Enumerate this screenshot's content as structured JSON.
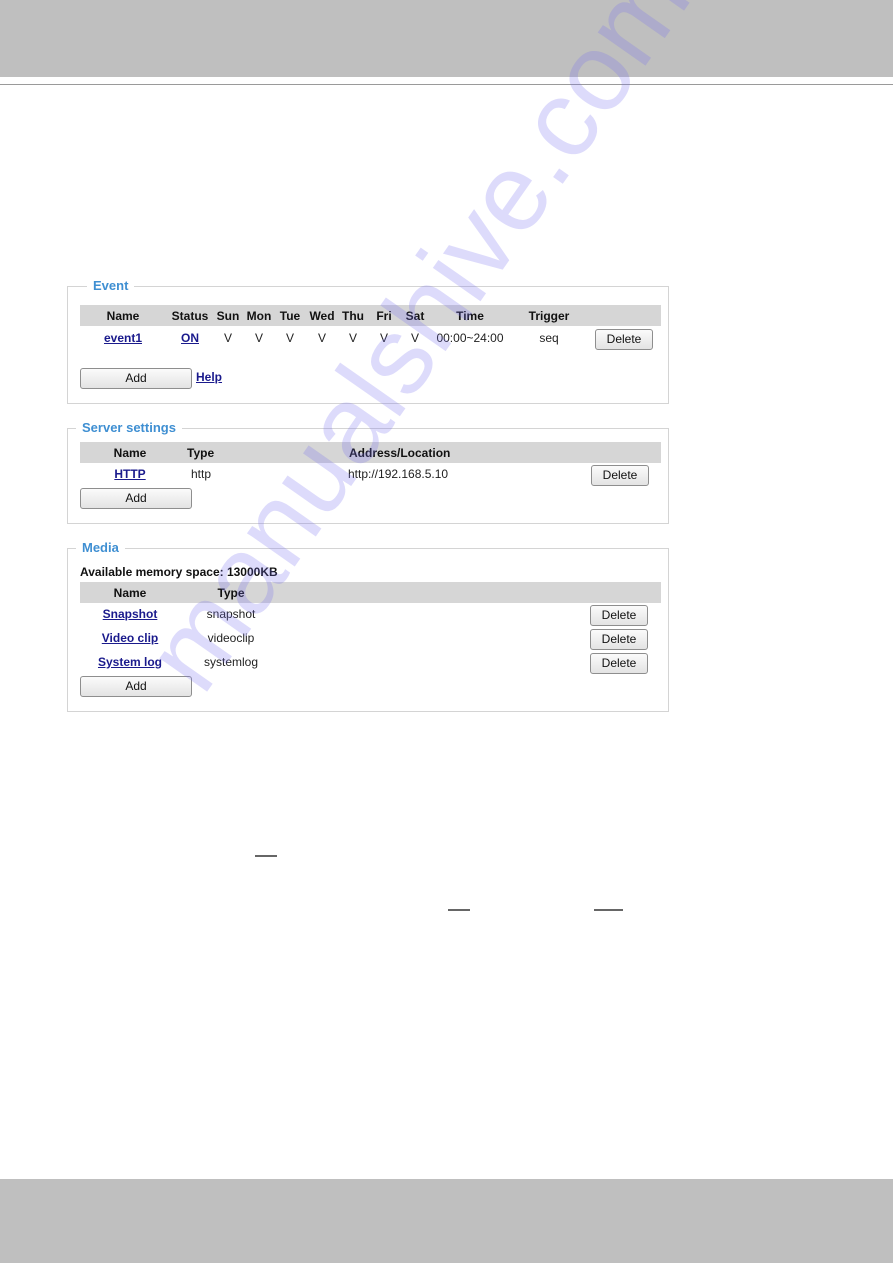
{
  "event": {
    "legend": "Event",
    "columns": [
      "Name",
      "Status",
      "Sun",
      "Mon",
      "Tue",
      "Wed",
      "Thu",
      "Fri",
      "Sat",
      "Time",
      "Trigger"
    ],
    "rows": [
      {
        "name": "event1",
        "status": "ON",
        "days": [
          "V",
          "V",
          "V",
          "V",
          "V",
          "V",
          "V"
        ],
        "time": "00:00~24:00",
        "trigger": "seq",
        "delete_label": "Delete"
      }
    ],
    "add_label": "Add",
    "help_label": "Help"
  },
  "server": {
    "legend": "Server settings",
    "columns": [
      "Name",
      "Type",
      "Address/Location"
    ],
    "rows": [
      {
        "name": "HTTP",
        "type": "http",
        "address": "http://192.168.5.10",
        "delete_label": "Delete"
      }
    ],
    "add_label": "Add"
  },
  "media": {
    "legend": "Media",
    "memory_label": "Available memory space: 13000KB",
    "columns": [
      "Name",
      "Type"
    ],
    "rows": [
      {
        "name": "Snapshot",
        "type": "snapshot",
        "delete_label": "Delete"
      },
      {
        "name": "Video clip",
        "type": "videoclip",
        "delete_label": "Delete"
      },
      {
        "name": "System log",
        "type": "systemlog",
        "delete_label": "Delete"
      }
    ],
    "add_label": "Add"
  },
  "watermark": "manualshive.com",
  "colors": {
    "legend": "#3f8fd2",
    "link": "#1a1a8c",
    "header_row": "#d6d6d6",
    "band": "#bfbfbf"
  }
}
